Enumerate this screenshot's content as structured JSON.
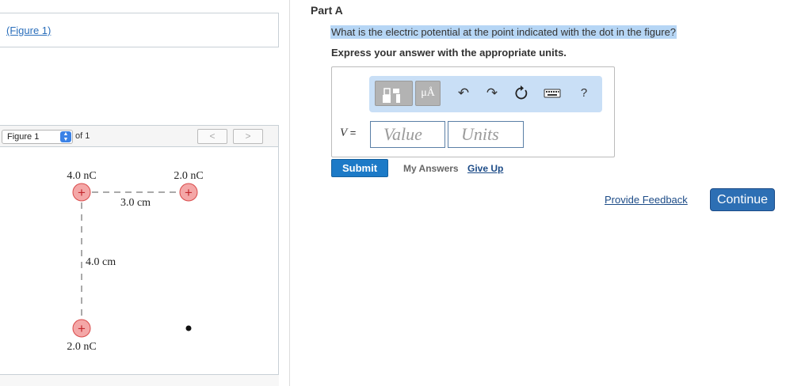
{
  "left_panel": {
    "figure_link": "(Figure 1)",
    "figure_select": "Figure 1",
    "of_text": "of 1",
    "prev_label": "<",
    "next_label": ">"
  },
  "figure": {
    "charge_top_left": "4.0 nC",
    "charge_top_right": "2.0 nC",
    "charge_bottom_left": "2.0 nC",
    "horizontal_distance": "3.0 cm",
    "vertical_distance": "4.0 cm",
    "plus_symbol": "+"
  },
  "question": {
    "part_title": "Part A",
    "text": "What is the electric potential at the point indicated with the dot in the figure?",
    "instruction": "Express your answer with the appropriate units."
  },
  "answer": {
    "variable_label": "V",
    "equals": " =",
    "value_placeholder": "Value",
    "units_placeholder": "Units",
    "toolbar": {
      "units_label": "μÅ",
      "templates_icon": "templates-icon",
      "undo_icon": "undo-icon",
      "redo_icon": "redo-icon",
      "reset_icon": "reset-icon",
      "keyboard_icon": "keyboard-icon",
      "help_label": "?"
    }
  },
  "actions": {
    "submit": "Submit",
    "my_answers": "My Answers",
    "give_up": "Give Up",
    "provide_feedback": "Provide Feedback",
    "continue": "Continue"
  },
  "colors": {
    "link": "#2a6ebb",
    "submit_bg": "#1c7ac7",
    "continue_bg": "#2d6fb4",
    "toolbar_bg": "#c9dff6",
    "charge_fill": "#f4a7a7",
    "charge_stroke": "#d94a4a"
  }
}
